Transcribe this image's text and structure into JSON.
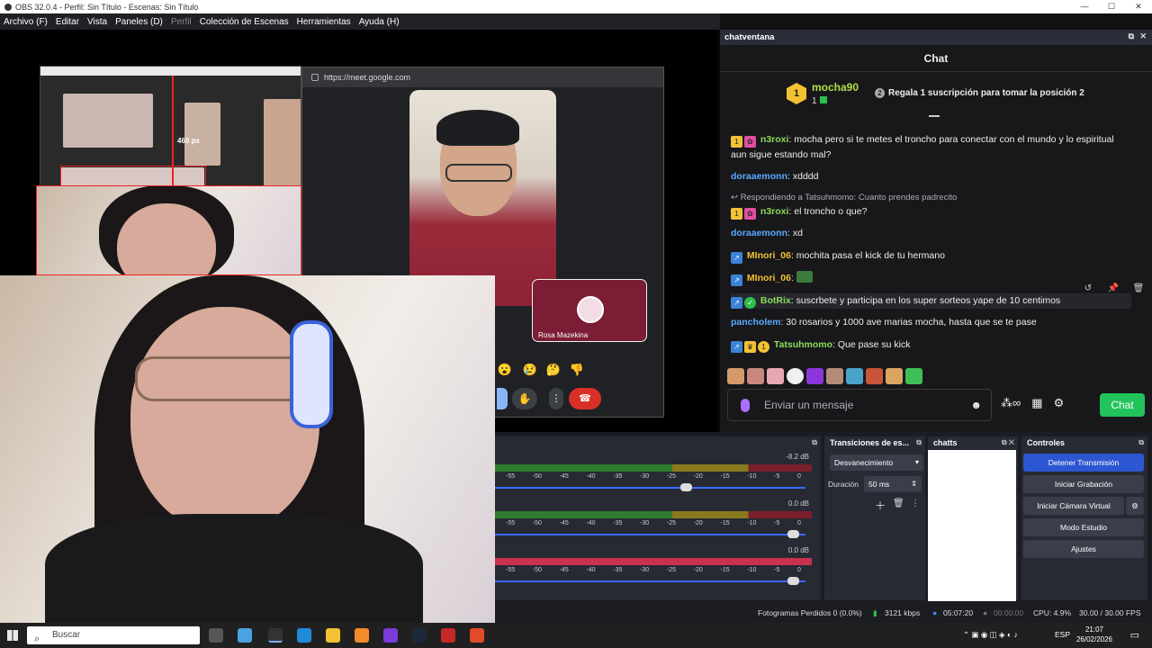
{
  "window": {
    "title": "OBS 32.0.4 - Perfil: Sin Título - Escenas: Sin Título",
    "controls": [
      "—",
      "☐",
      "✕"
    ]
  },
  "menu": [
    {
      "label": "Archivo (F)",
      "enabled": true
    },
    {
      "label": "Editar",
      "enabled": true
    },
    {
      "label": "Vista",
      "enabled": true
    },
    {
      "label": "Paneles (D)",
      "enabled": true
    },
    {
      "label": "Perfil",
      "enabled": false
    },
    {
      "label": "Colección de Escenas",
      "enabled": true
    },
    {
      "label": "Herramientas",
      "enabled": true
    },
    {
      "label": "Ayuda (H)",
      "enabled": true
    }
  ],
  "preview": {
    "nested_size_label": "460 px",
    "meet": {
      "url": "https://meet.google.com",
      "participant_name": "Rosa Mazekina",
      "reactions": [
        "😮",
        "😢",
        "🤔",
        "👎"
      ],
      "end_call_icon": "phone-hangup-icon"
    }
  },
  "chat": {
    "dock_title": "chatventana",
    "title": "Chat",
    "leader": {
      "rank": "1",
      "username": "mocha90",
      "count": "1",
      "gift_text": "Regala 1 suscripción para tomar la posición 2"
    },
    "messages": [
      {
        "user": "n3roxi",
        "user_color": "#8bdc5a",
        "badges": [
          "sub-gold-1",
          "paw-pink"
        ],
        "text": "mocha pero si te metes el troncho para conectar con el mundo y lo espiritual aun sigue estando mal?"
      },
      {
        "user": "doraaemonn",
        "user_color": "#5aa9ff",
        "badges": [],
        "text": "xdddd"
      },
      {
        "reply_to": "Respondiendo a Tatsuhmomo: Cuanto prendes padrecito"
      },
      {
        "user": "n3roxi",
        "user_color": "#8bdc5a",
        "badges": [
          "sub-gold-1",
          "paw-pink"
        ],
        "text": "el troncho o que?"
      },
      {
        "user": "doraaemonn",
        "user_color": "#5aa9ff",
        "badges": [],
        "text": "xd"
      },
      {
        "user": "MInori_06",
        "user_color": "#f2c233",
        "badges": [
          "prime-blue"
        ],
        "text": "mochita pasa el kick de tu hermano"
      },
      {
        "user": "MInori_06",
        "user_color": "#f2c233",
        "badges": [
          "prime-blue"
        ],
        "text": ""
      },
      {
        "user": "BotRix",
        "user_color": "#8bdc5a",
        "badges": [
          "prime-blue",
          "verified-green"
        ],
        "text": "suscrbete y participa en los super sorteos yape de 10 centimos"
      },
      {
        "user": "pancholem",
        "user_color": "#5aa9ff",
        "badges": [],
        "text": "30 rosarios y 1000 ave marias mocha, hasta que se te pase"
      },
      {
        "user": "Tatsuhmomo",
        "user_color": "#8bdc5a",
        "badges": [
          "prime-blue",
          "crown-gold",
          "sub-gold-1"
        ],
        "text": "Que pase su kick"
      }
    ],
    "input_placeholder": "Enviar un mensaje",
    "send_label": "Chat"
  },
  "mixer": {
    "channels": [
      {
        "db": "-8.2 dB",
        "volume": 0.62
      },
      {
        "db": "0.0 dB",
        "volume": 0.98
      },
      {
        "db": "0.0 dB",
        "volume": 0.98
      }
    ],
    "ticks": [
      "-55",
      "-50",
      "-45",
      "-40",
      "-35",
      "-30",
      "-25",
      "-20",
      "-15",
      "-10",
      "-5",
      "0"
    ]
  },
  "transitions": {
    "title": "Transiciones de es...",
    "selected": "Desvanecimiento",
    "duration_label": "Duración",
    "duration_value": "50 ms"
  },
  "chatts": {
    "title": "chatts"
  },
  "controls": {
    "title": "Controles",
    "buttons": [
      "Detener Transmisión",
      "Iniciar Grabación",
      "Iniciar Cámara Virtual",
      "Modo Estudio",
      "Ajustes"
    ]
  },
  "status": {
    "dropped": "Fotogramas Perdidos 0 (0.0%)",
    "bitrate": "3121 kbps",
    "stream_time": "05:07:20",
    "rec_time": "00:00:00",
    "cpu": "CPU: 4.9%",
    "fps": "30.00 / 30.00 FPS"
  },
  "taskbar": {
    "search_placeholder": "Buscar",
    "lang": "ESP",
    "time": "21:07",
    "date": "26/02/2026"
  }
}
